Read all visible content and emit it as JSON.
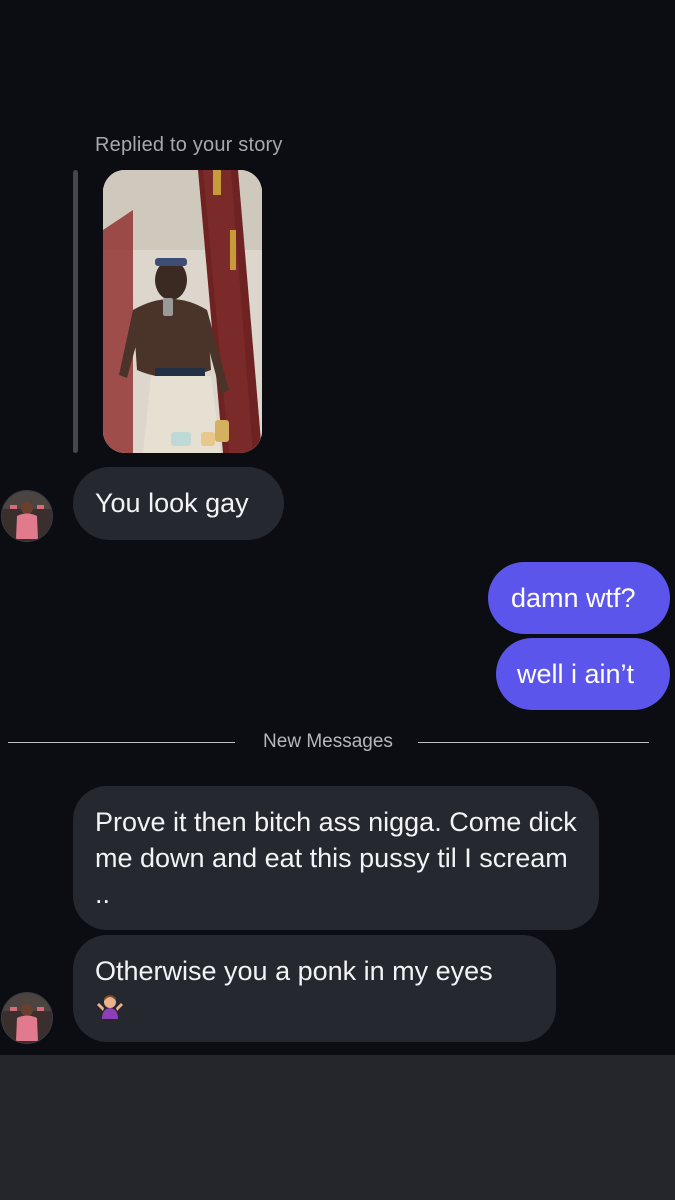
{
  "conversation": {
    "reply_label": "Replied to your story",
    "divider_label": "New Messages",
    "messages": [
      {
        "from": "them",
        "text": "You look gay"
      },
      {
        "from": "me",
        "text": "damn wtf?"
      },
      {
        "from": "me",
        "text": "well i ain’t"
      },
      {
        "from": "them",
        "text": "Prove it then bitch ass nigga. Come dick me down and eat this pussy til I scream .."
      },
      {
        "from": "them",
        "text": "Otherwise you a ponk in my eyes",
        "emoji": "person-shrugging-emoji"
      }
    ]
  },
  "colors": {
    "background": "#0b0d12",
    "incoming_bubble": "#25282e",
    "outgoing_bubble": "#5b55eb",
    "composer_area": "#24262b"
  }
}
